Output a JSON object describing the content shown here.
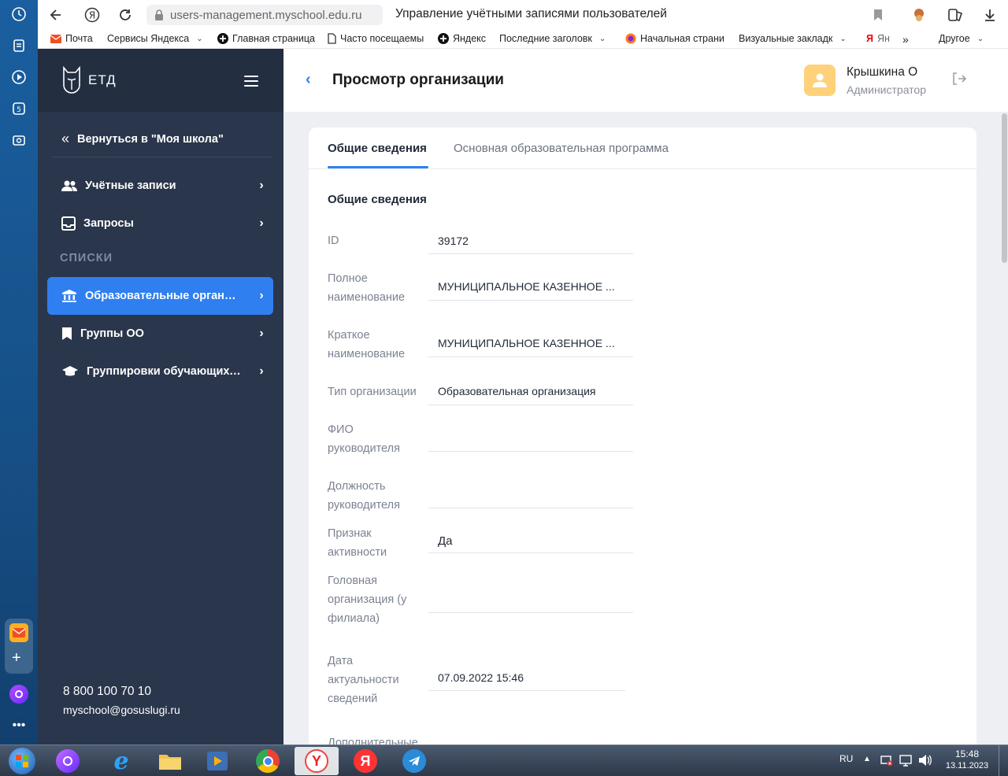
{
  "browser": {
    "url": "users-management.myschool.edu.ru",
    "tab_title": "Управление учётными записями пользователей",
    "bookmarks": [
      "Почта",
      "Сервисы Яндекса",
      "Главная страница",
      "Часто посещаемы",
      "Яндекс",
      "Последние заголовк",
      "Начальная страни",
      "Визуальные закладк",
      "Ян",
      "Другое"
    ]
  },
  "sidebar": {
    "logo_text": "ЕТД",
    "back_label": "Вернуться в \"Моя школа\"",
    "items": [
      {
        "label": "Учётные записи",
        "icon": "users-icon"
      },
      {
        "label": "Запросы",
        "icon": "inbox-icon"
      }
    ],
    "section_label": "СПИСКИ",
    "list_items": [
      {
        "label": "Образовательные организа...",
        "icon": "bank-icon",
        "active": true
      },
      {
        "label": "Группы ОО",
        "icon": "bookmark-icon"
      },
      {
        "label": "Группировки обучающихся",
        "icon": "graduation-cap-icon"
      }
    ],
    "phone": "8 800 100 70 10",
    "email": "myschool@gosuslugi.ru"
  },
  "header": {
    "title": "Просмотр организации",
    "user_name": "Крышкина О",
    "user_role": "Администратор"
  },
  "tabs": [
    {
      "label": "Общие сведения",
      "active": true
    },
    {
      "label": "Основная образовательная программа",
      "active": false
    }
  ],
  "section_title": "Общие сведения",
  "fields": [
    {
      "label": "ID",
      "value": "39172"
    },
    {
      "label": "Полное наименование",
      "value": "МУНИЦИПАЛЬНОЕ КАЗЕННОЕ ..."
    },
    {
      "label": "Краткое наименование",
      "value": "МУНИЦИПАЛЬНОЕ КАЗЕННОЕ ..."
    },
    {
      "label": "Тип организации",
      "value": "Образовательная организация"
    },
    {
      "label": "ФИО руководителя",
      "value": ""
    },
    {
      "label": "Должность руководителя",
      "value": ""
    },
    {
      "label": "Признак активности",
      "value": "Да"
    },
    {
      "label": "Головная организация (у филиала)",
      "value": ""
    },
    {
      "label": "Дата актуальности сведений",
      "value": "07.09.2022 15:46"
    },
    {
      "label": "Дополнительные",
      "value": ""
    }
  ],
  "taskbar": {
    "lang": "RU",
    "time": "15:48",
    "date": "13.11.2023"
  },
  "colors": {
    "accent": "#2f7ff0",
    "sidebar_bg": "#2a364b",
    "avatar_bg": "#ffd17a"
  }
}
